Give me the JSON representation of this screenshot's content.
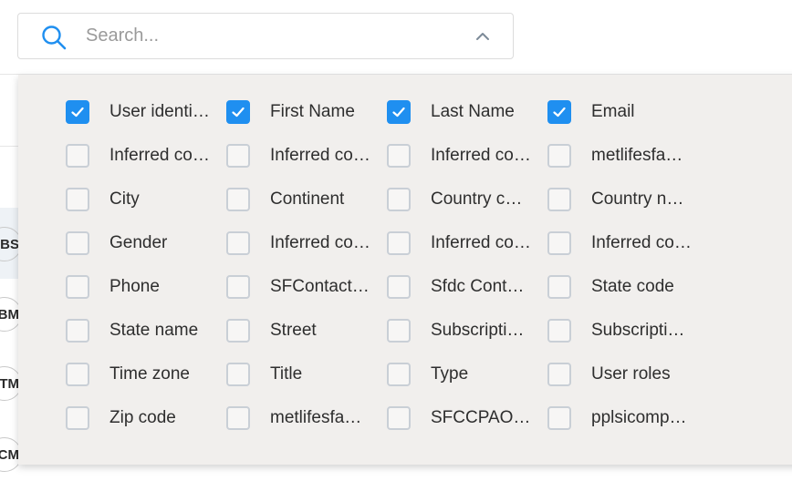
{
  "search": {
    "placeholder": "Search..."
  },
  "background": {
    "avatars": [
      "BS",
      "BM",
      "TM",
      "CM"
    ]
  },
  "columns": {
    "options": [
      {
        "label": "User identi…",
        "checked": true
      },
      {
        "label": "First Name",
        "checked": true
      },
      {
        "label": "Last Name",
        "checked": true
      },
      {
        "label": "Email",
        "checked": true
      },
      {
        "label": "Inferred co…",
        "checked": false
      },
      {
        "label": "Inferred co…",
        "checked": false
      },
      {
        "label": "Inferred co…",
        "checked": false
      },
      {
        "label": "metlifesfa…",
        "checked": false
      },
      {
        "label": "City",
        "checked": false
      },
      {
        "label": "Continent",
        "checked": false
      },
      {
        "label": "Country co…",
        "checked": false
      },
      {
        "label": "Country na…",
        "checked": false
      },
      {
        "label": "Gender",
        "checked": false
      },
      {
        "label": "Inferred co…",
        "checked": false
      },
      {
        "label": "Inferred co…",
        "checked": false
      },
      {
        "label": "Inferred co…",
        "checked": false
      },
      {
        "label": "Phone",
        "checked": false
      },
      {
        "label": "SFContact…",
        "checked": false
      },
      {
        "label": "Sfdc Cont…",
        "checked": false
      },
      {
        "label": "State code",
        "checked": false
      },
      {
        "label": "State name",
        "checked": false
      },
      {
        "label": "Street",
        "checked": false
      },
      {
        "label": "Subscripti…",
        "checked": false
      },
      {
        "label": "Subscripti…",
        "checked": false
      },
      {
        "label": "Time zone",
        "checked": false
      },
      {
        "label": "Title",
        "checked": false
      },
      {
        "label": "Type",
        "checked": false
      },
      {
        "label": "User roles",
        "checked": false
      },
      {
        "label": "Zip code",
        "checked": false
      },
      {
        "label": "metlifesfa…",
        "checked": false
      },
      {
        "label": "SFCCPAO…",
        "checked": false
      },
      {
        "label": "pplsicomp…",
        "checked": false
      }
    ]
  },
  "colors": {
    "accent": "#1f8ff0",
    "panel_bg": "#f1efed",
    "search_icon": "#1f8ff0"
  },
  "icons": {
    "search": "search-icon",
    "chevron": "chevron-up-icon",
    "check": "check-icon"
  }
}
